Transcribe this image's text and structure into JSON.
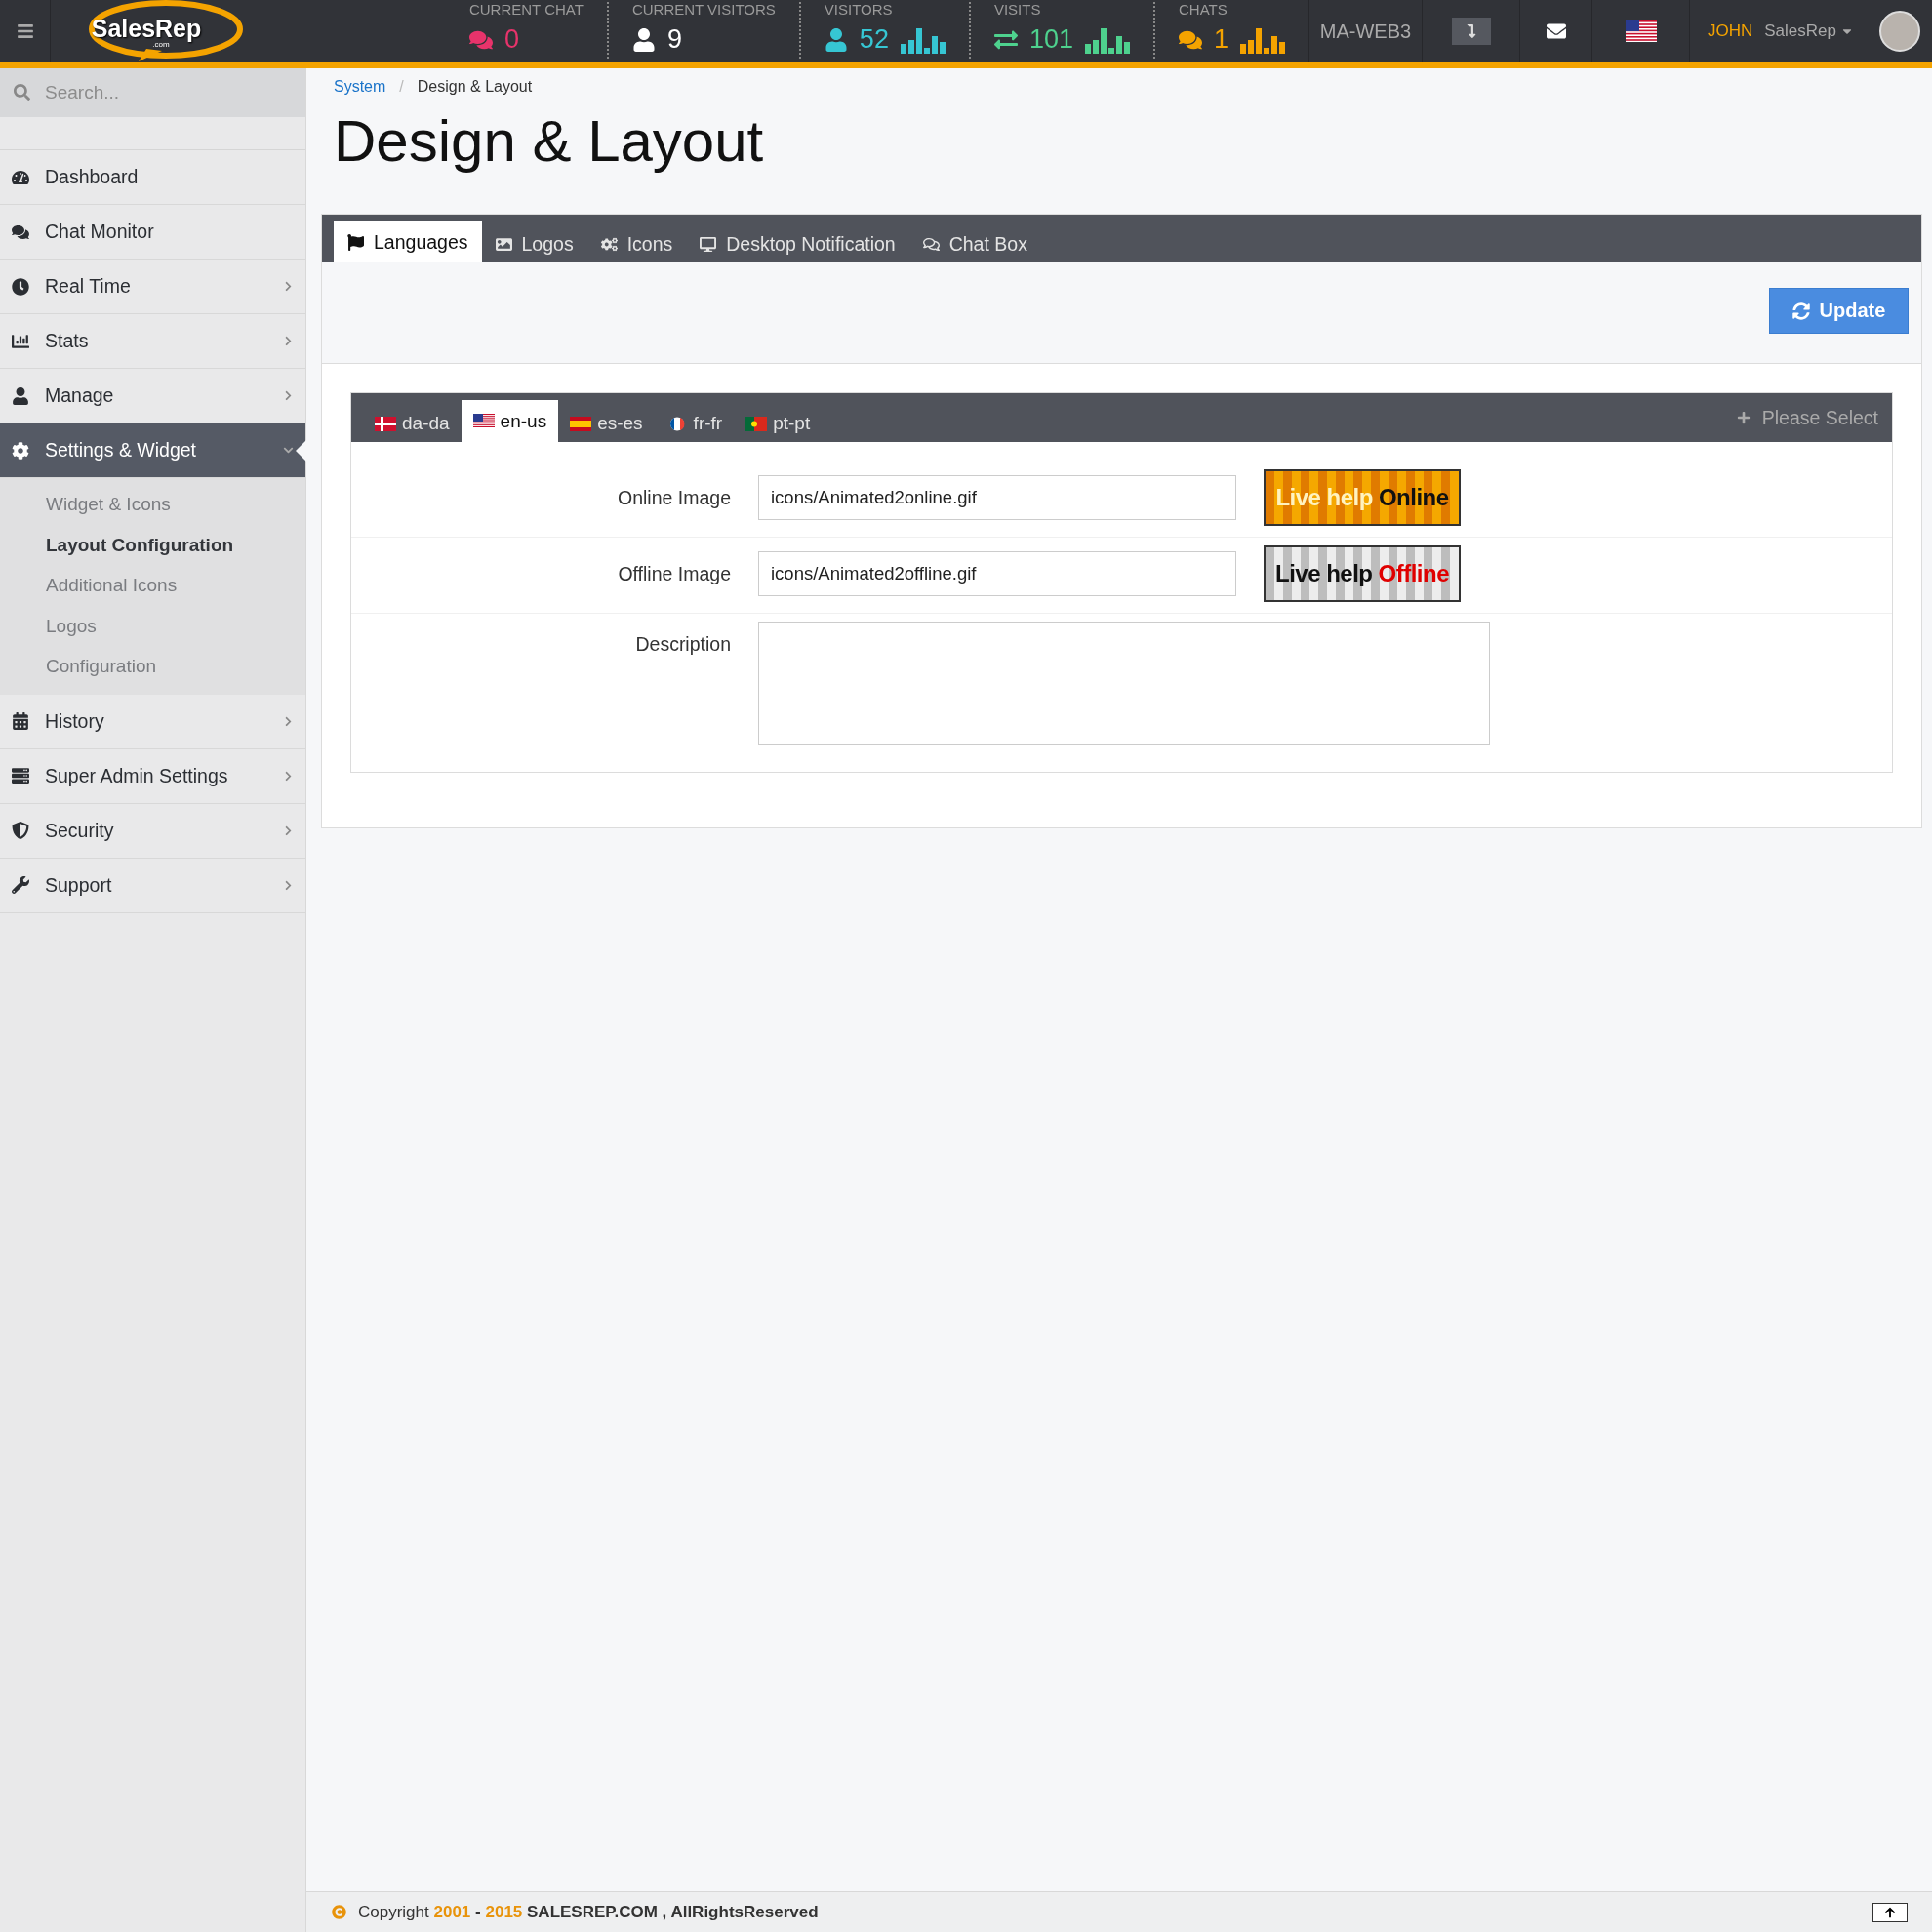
{
  "header": {
    "logo": {
      "name": "SalesRep",
      "suffix": ".com"
    },
    "stats": [
      {
        "label": "CURRENT CHAT",
        "value": "0",
        "color": "#e8336b",
        "kind": "plain"
      },
      {
        "label": "CURRENT VISITORS",
        "value": "9",
        "color": "#ffffff",
        "kind": "plain"
      },
      {
        "label": "VISITORS",
        "value": "52",
        "color": "#36c6d3",
        "kind": "chart"
      },
      {
        "label": "VISITS",
        "value": "101",
        "color": "#4ed28e",
        "kind": "chart"
      },
      {
        "label": "CHATS",
        "value": "1",
        "color": "#f4a300",
        "kind": "chart"
      }
    ],
    "server": "MA-WEB3",
    "user": {
      "first_name": "JOHN",
      "role": "SalesRep"
    }
  },
  "sidebar": {
    "search": {
      "placeholder": "Search..."
    },
    "items": [
      {
        "label": "Dashboard",
        "kind": "link",
        "selected": false
      },
      {
        "label": "Chat Monitor",
        "kind": "link",
        "selected": false
      },
      {
        "label": "Real Time",
        "kind": "submenu",
        "selected": false,
        "expanded": false
      },
      {
        "label": "Stats",
        "kind": "submenu",
        "selected": false,
        "expanded": false
      },
      {
        "label": "Manage",
        "kind": "submenu",
        "selected": false,
        "expanded": false
      },
      {
        "label": "Settings & Widget",
        "kind": "submenu",
        "selected": true,
        "expanded": true,
        "children": [
          {
            "label": "Widget & Icons",
            "selected": false
          },
          {
            "label": "Layout Configuration",
            "selected": true
          },
          {
            "label": "Additional Icons",
            "selected": false
          },
          {
            "label": "Logos",
            "selected": false
          },
          {
            "label": "Configuration",
            "selected": false
          }
        ]
      },
      {
        "label": "History",
        "kind": "submenu",
        "selected": false,
        "expanded": false
      },
      {
        "label": "Super Admin Settings",
        "kind": "submenu",
        "selected": false,
        "expanded": false
      },
      {
        "label": "Security",
        "kind": "submenu",
        "selected": false,
        "expanded": false
      },
      {
        "label": "Support",
        "kind": "submenu",
        "selected": false,
        "expanded": false
      }
    ]
  },
  "breadcrumb": {
    "separator": "/",
    "items": [
      {
        "label": "System",
        "kind": "link"
      },
      {
        "label": "Design & Layout",
        "kind": "current"
      }
    ]
  },
  "title": "Design & Layout",
  "tabs": [
    {
      "label": "Languages",
      "selected": true
    },
    {
      "label": "Logos",
      "selected": false
    },
    {
      "label": "Icons",
      "selected": false
    },
    {
      "label": "Desktop Notification",
      "selected": false
    },
    {
      "label": "Chat Box",
      "selected": false
    }
  ],
  "update_button": "Update",
  "languages": [
    {
      "code": "da-da",
      "selected": false
    },
    {
      "code": "en-us",
      "selected": true
    },
    {
      "code": "es-es",
      "selected": false
    },
    {
      "code": "fr-fr",
      "selected": false
    },
    {
      "code": "pt-pt",
      "selected": false
    }
  ],
  "language_select": "Please Select",
  "form": [
    {
      "label": "Online Image",
      "kind": "online",
      "value": "icons/Animated2online.gif",
      "banner": {
        "text": "Live help",
        "status": "Online"
      }
    },
    {
      "label": "Offline Image",
      "kind": "offline",
      "value": "icons/Animated2offline.gif",
      "banner": {
        "text": "Live help",
        "status": "Offline"
      }
    },
    {
      "label": "Description",
      "kind": "textarea"
    }
  ],
  "footer": {
    "text": "Copyright",
    "year_from": "2001",
    "separator": "-",
    "year_to": "2015",
    "owner": "SALESREP.COM , AllRightsReserved"
  }
}
